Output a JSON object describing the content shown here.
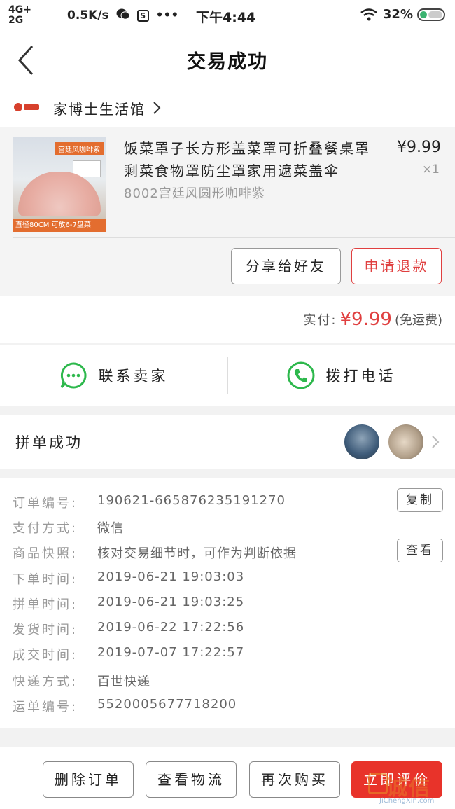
{
  "status_bar": {
    "net_top": "4G+",
    "net_bottom": "2G",
    "speed": "0.5K/s",
    "time": "下午4:44",
    "battery": "32%"
  },
  "header": {
    "title": "交易成功"
  },
  "shop": {
    "name": "家博士生活馆"
  },
  "product": {
    "title": "饭菜罩子长方形盖菜罩可折叠餐桌罩剩菜食物罩防尘罩家用遮菜盖伞",
    "variant": "8002宫廷风圆形咖啡紫",
    "price": "¥9.99",
    "qty": "×1",
    "thumb_tag": "宫廷风咖啡紫",
    "thumb_caption": "直径80CM 可放6-7盘菜",
    "share_label": "分享给好友",
    "refund_label": "申请退款"
  },
  "payment": {
    "label": "实付:",
    "amount": "¥9.99",
    "note": "(免运费)"
  },
  "contact": {
    "seller_label": "联系卖家",
    "phone_label": "拨打电话"
  },
  "group": {
    "label": "拼单成功"
  },
  "details": {
    "rows": [
      {
        "key": "订单编号:",
        "value": "190621-665876235191270"
      },
      {
        "key": "支付方式:",
        "value": "微信"
      },
      {
        "key": "商品快照:",
        "value": "核对交易细节时，可作为判断依据"
      },
      {
        "key": "下单时间:",
        "value": "2019-06-21 19:03:03"
      },
      {
        "key": "拼单时间:",
        "value": "2019-06-21 19:03:25"
      },
      {
        "key": "发货时间:",
        "value": "2019-06-22 17:22:56"
      },
      {
        "key": "成交时间:",
        "value": "2019-07-07 17:22:57"
      },
      {
        "key": "快递方式:",
        "value": "百世快递"
      },
      {
        "key": "运单编号:",
        "value": "5520005677718200"
      }
    ],
    "copy_label": "复制",
    "view_label": "查看"
  },
  "bottom": {
    "delete_label": "删除订单",
    "logistics_label": "查看物流",
    "rebuy_label": "再次购买",
    "review_label": "立即评价"
  },
  "watermark": {
    "text": "诚信",
    "sub": "JiChengXin.com"
  },
  "colors": {
    "accent_red": "#e8332a",
    "wechat_green": "#2db84c"
  }
}
